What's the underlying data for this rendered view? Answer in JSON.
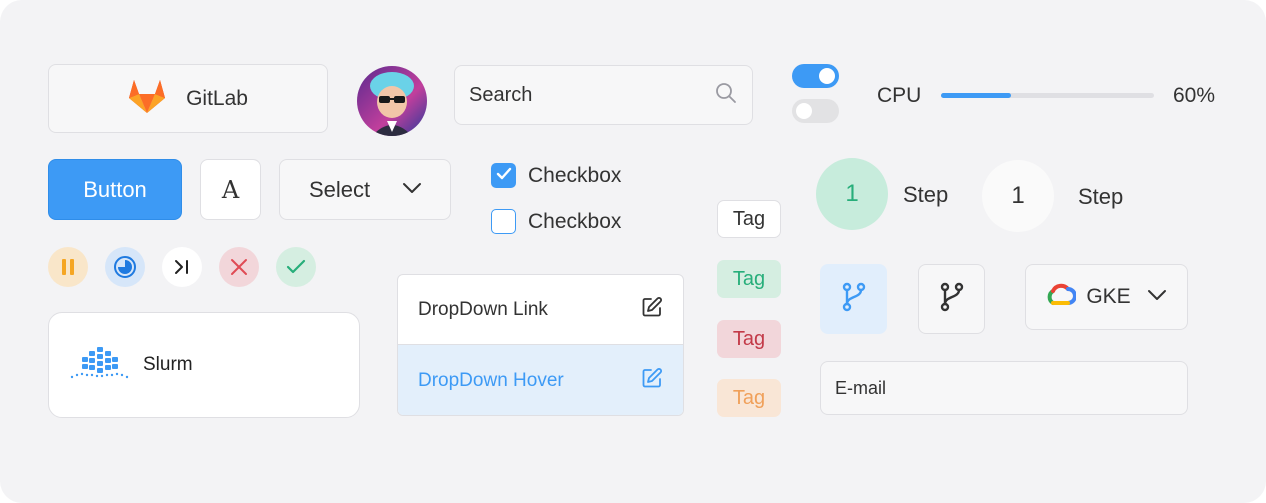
{
  "gitlab": {
    "label": "GitLab",
    "icon": "gitlab-icon"
  },
  "avatar": {
    "icon": "avatar"
  },
  "search": {
    "placeholder": "Search",
    "icon": "search-icon"
  },
  "toggles": [
    {
      "state": "on",
      "color": "#3d9af5"
    },
    {
      "state": "off",
      "color": "#e2e2e4"
    }
  ],
  "cpu": {
    "label": "CPU",
    "value": "60%",
    "fraction": 0.33
  },
  "buttons": {
    "primary_label": "Button",
    "font_label": "A",
    "select_label": "Select"
  },
  "checkboxes": [
    {
      "label": "Checkbox",
      "checked": true
    },
    {
      "label": "Checkbox",
      "checked": false
    }
  ],
  "status_icons": [
    "pause-icon",
    "progress-icon",
    "skip-icon",
    "close-icon",
    "check-icon"
  ],
  "slurm": {
    "label": "Slurm",
    "icon": "slurm-logo"
  },
  "dropdown": {
    "items": [
      {
        "label": "DropDown Link",
        "icon": "edit-icon"
      },
      {
        "label": "DropDown Hover",
        "icon": "edit-icon"
      }
    ]
  },
  "tags": [
    {
      "label": "Tag",
      "style": "default"
    },
    {
      "label": "Tag",
      "style": "success",
      "color": "#27ae7a"
    },
    {
      "label": "Tag",
      "style": "danger",
      "color": "#c33a48"
    },
    {
      "label": "Tag",
      "style": "warning",
      "color": "#f0a05a"
    }
  ],
  "steps": [
    {
      "number": "1",
      "label": "Step",
      "active": true
    },
    {
      "number": "1",
      "label": "Step",
      "active": false
    }
  ],
  "branch_buttons": [
    {
      "icon": "branch-icon",
      "active": true
    },
    {
      "icon": "branch-icon",
      "active": false
    }
  ],
  "gke": {
    "label": "GKE",
    "icon": "google-cloud-icon"
  },
  "email": {
    "placeholder": "E-mail"
  },
  "colors": {
    "accent": "#3d9af5",
    "background": "#f3f3f5",
    "border": "#dfdfe3"
  }
}
